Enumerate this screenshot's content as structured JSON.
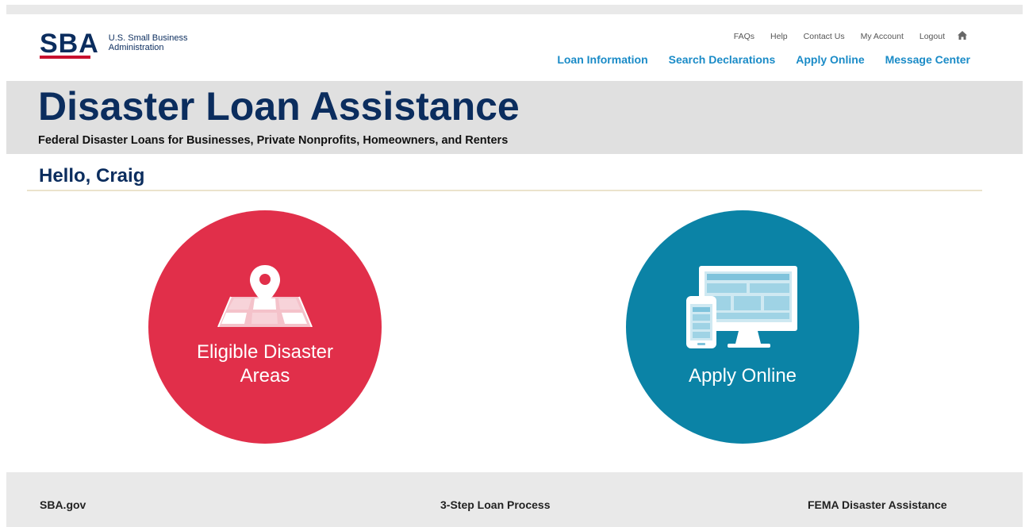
{
  "logo": {
    "mark": "SBA",
    "text": "U.S. Small Business Administration"
  },
  "utility_nav": [
    "FAQs",
    "Help",
    "Contact Us",
    "My Account",
    "Logout"
  ],
  "main_nav": [
    "Loan Information",
    "Search Declarations",
    "Apply Online",
    "Message Center"
  ],
  "banner": {
    "title": "Disaster Loan Assistance",
    "subtitle": "Federal Disaster Loans for Businesses, Private Nonprofits, Homeowners, and Renters"
  },
  "greeting": "Hello, Craig",
  "tiles": {
    "eligible": {
      "line1": "Eligible Disaster",
      "line2": "Areas",
      "color": "#e12f4a",
      "icon": "map-pin-icon"
    },
    "apply": {
      "label": "Apply Online",
      "color": "#0b83a6",
      "icon": "devices-icon"
    }
  },
  "footer": {
    "left": "SBA.gov",
    "center": "3-Step Loan Process",
    "right": "FEMA Disaster Assistance"
  },
  "colors": {
    "navy": "#0b2d5e",
    "link_blue": "#1a8bc7",
    "accent_red": "#c8102e"
  }
}
